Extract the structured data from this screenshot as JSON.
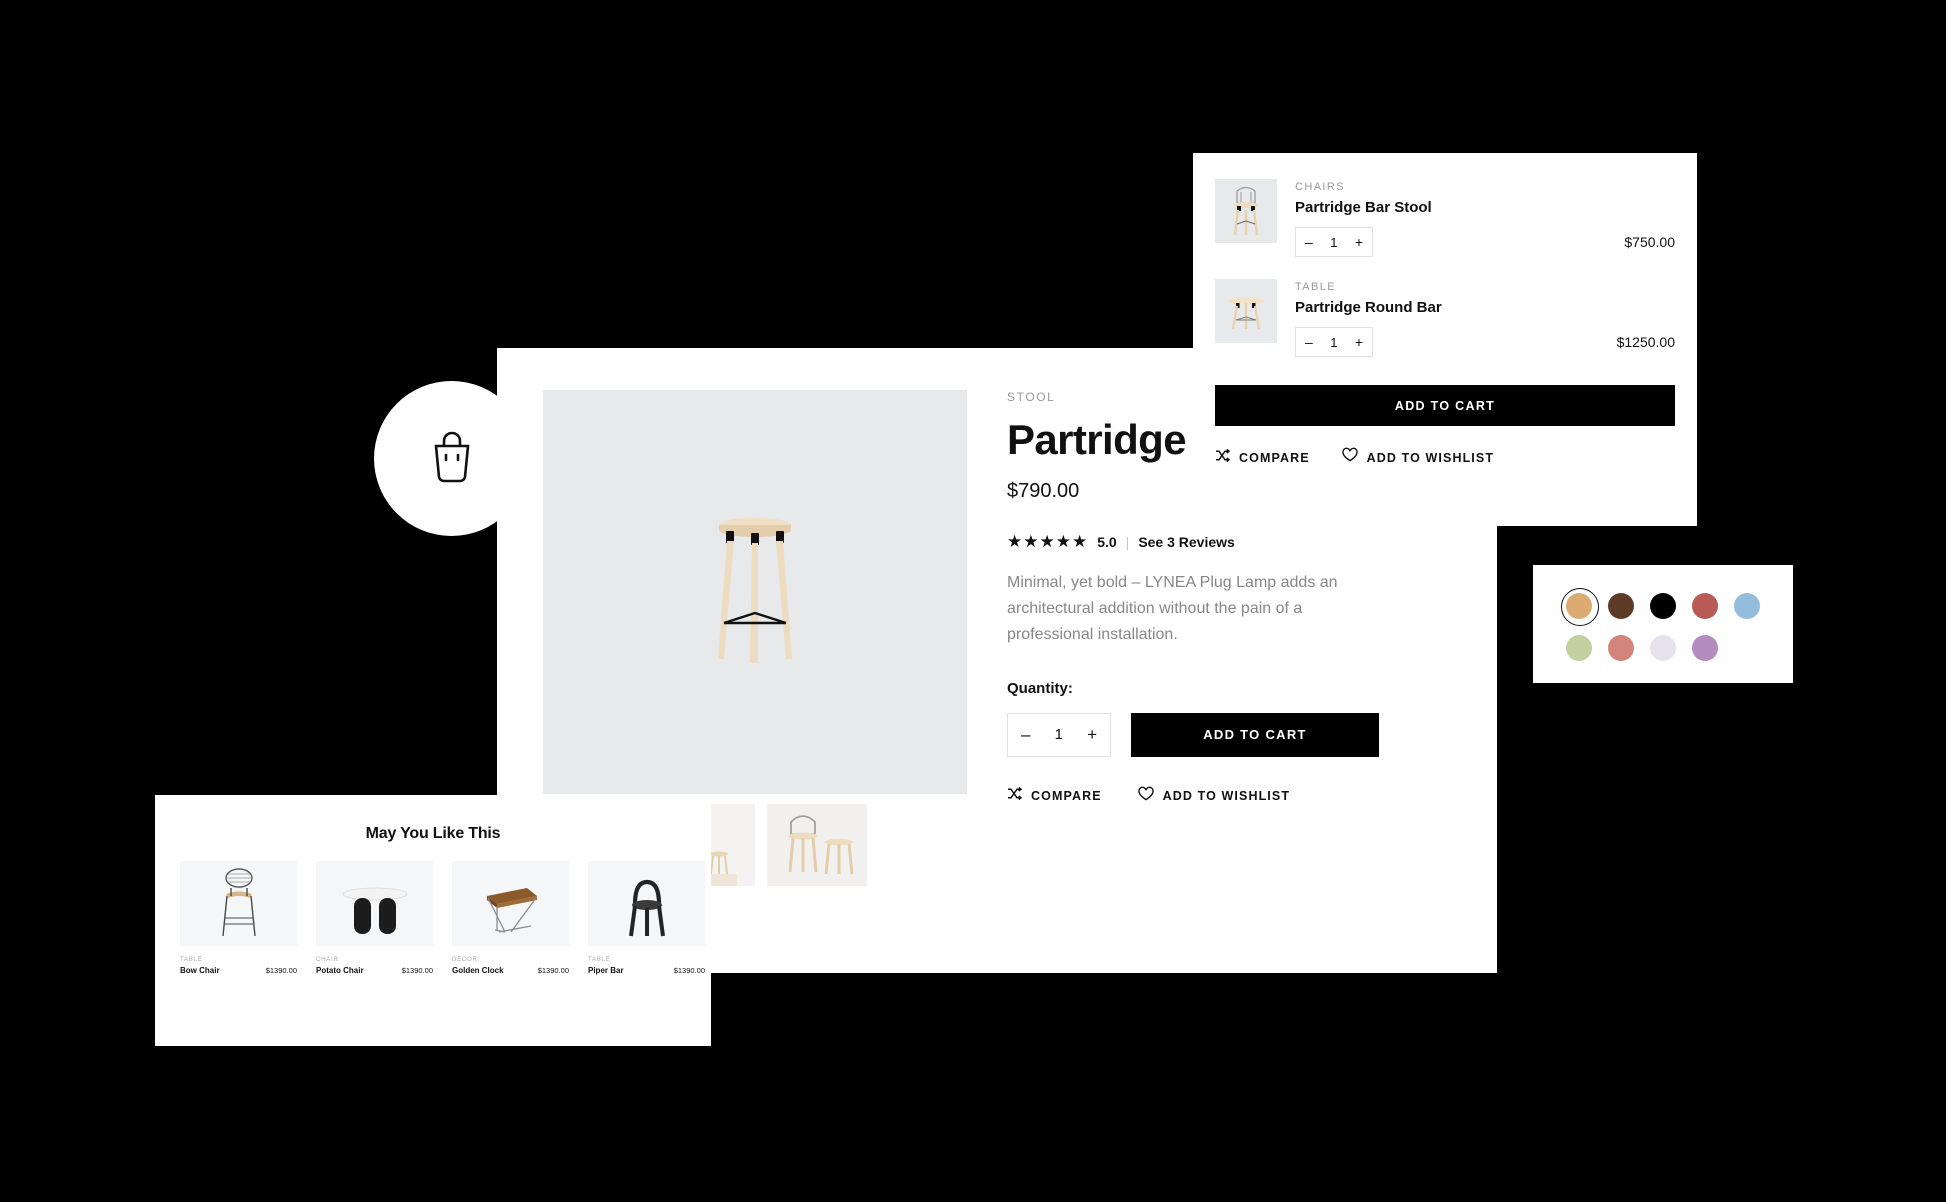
{
  "bag": {
    "icon": "shopping-bag-icon"
  },
  "product": {
    "category": "STOOL",
    "title": "Partridge",
    "price": "$790.00",
    "stars": "★★★★★",
    "rating_value": "5.0",
    "divider": "|",
    "reviews_link": "See 3 Reviews",
    "description": "Minimal, yet bold – LYNEA Plug Lamp adds an architectural addition without the pain of a professional installation.",
    "quantity_label": "Quantity:",
    "quantity_value": "1",
    "minus": "–",
    "plus": "+",
    "add_to_cart": "ADD TO CART",
    "compare": "COMPARE",
    "wishlist": "ADD TO WISHLIST"
  },
  "cart": {
    "items": [
      {
        "category": "CHAIRS",
        "name": "Partridge Bar Stool",
        "quantity": "1",
        "price": "$750.00",
        "minus": "–",
        "plus": "+"
      },
      {
        "category": "TABLE",
        "name": "Partridge Round Bar",
        "quantity": "1",
        "price": "$1250.00",
        "minus": "–",
        "plus": "+"
      }
    ],
    "add_to_cart": "ADD TO CART",
    "compare": "COMPARE",
    "wishlist": "ADD TO WISHLIST"
  },
  "swatches": {
    "colors": [
      {
        "name": "tan",
        "hex": "#dbab72",
        "selected": true
      },
      {
        "name": "dark-brown",
        "hex": "#5e3b26",
        "selected": false
      },
      {
        "name": "black",
        "hex": "#000000",
        "selected": false
      },
      {
        "name": "brick-red",
        "hex": "#b85a56",
        "selected": false
      },
      {
        "name": "sky-blue",
        "hex": "#93bddd",
        "selected": false
      },
      {
        "name": "sage-green",
        "hex": "#c4cfa0",
        "selected": false
      },
      {
        "name": "dusty-rose",
        "hex": "#d3857c",
        "selected": false
      },
      {
        "name": "lilac-white",
        "hex": "#e6e2ec",
        "selected": false
      },
      {
        "name": "orchid",
        "hex": "#b58cc0",
        "selected": false
      }
    ]
  },
  "recommendations": {
    "title": "May You Like This",
    "items": [
      {
        "category": "TABLE",
        "name": "Bow Chair",
        "price": "$1390.00"
      },
      {
        "category": "CHAIR",
        "name": "Potato Chair",
        "price": "$1390.00"
      },
      {
        "category": "DECOR",
        "name": "Golden Clock",
        "price": "$1390.00"
      },
      {
        "category": "TABLE",
        "name": "Piper Bar",
        "price": "$1390.00"
      }
    ]
  }
}
